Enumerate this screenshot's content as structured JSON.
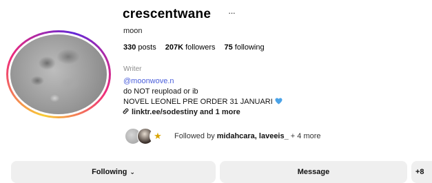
{
  "profile": {
    "username": "crescentwane",
    "more_icon": "···",
    "full_name": "moon",
    "stats": {
      "posts_count": "330",
      "posts_label": "posts",
      "followers_count": "207K",
      "followers_label": "followers",
      "following_count": "75",
      "following_label": "following"
    },
    "category": "Writer",
    "bio": {
      "mention": "@moonwove.n",
      "line1": "do NOT reupload or ib",
      "line2": "NOVEL LEONEL PRE ORDER 31 JANUARI",
      "link_text": "linktr.ee/sodestiny and 1 more"
    },
    "followed_by": {
      "prefix": "Followed by",
      "names": "midahcara, laveeis_",
      "suffix": "+ 4 more"
    }
  },
  "actions": {
    "following_label": "Following",
    "message_label": "Message",
    "add_user_label": "+8"
  },
  "colors": {
    "mention": "#4a5edb",
    "button_bg": "#efefef",
    "heart": "#4aa3e8"
  }
}
